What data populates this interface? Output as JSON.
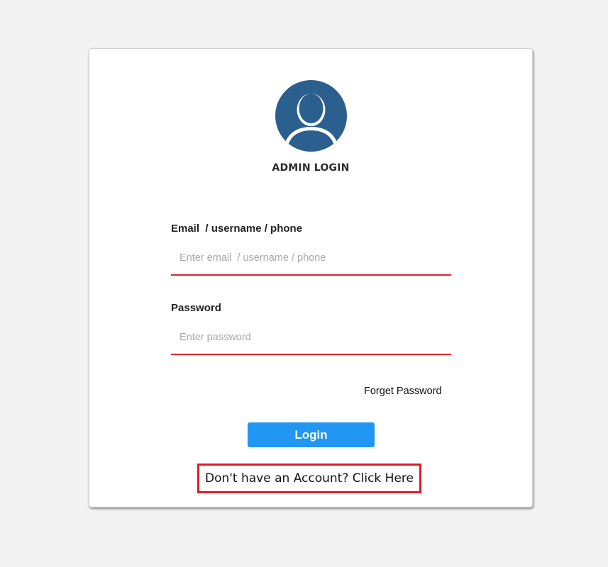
{
  "login": {
    "title": "ADMIN LOGIN",
    "avatar_icon": "user-avatar-icon",
    "email": {
      "label": "Email  / username / phone",
      "placeholder": "Enter email  / username / phone",
      "value": ""
    },
    "password": {
      "label": "Password",
      "placeholder": "Enter password",
      "value": ""
    },
    "forget_password_label": "Forget Password",
    "login_button_label": "Login",
    "signup_prompt": "Don't have an Account? Click Here"
  },
  "colors": {
    "page_background": "#f3f3f3",
    "card_background": "#ffffff",
    "avatar": "#2b5f8e",
    "input_underline": "#e3262a",
    "login_button": "#2196f3",
    "highlight_border": "#e31b24"
  }
}
